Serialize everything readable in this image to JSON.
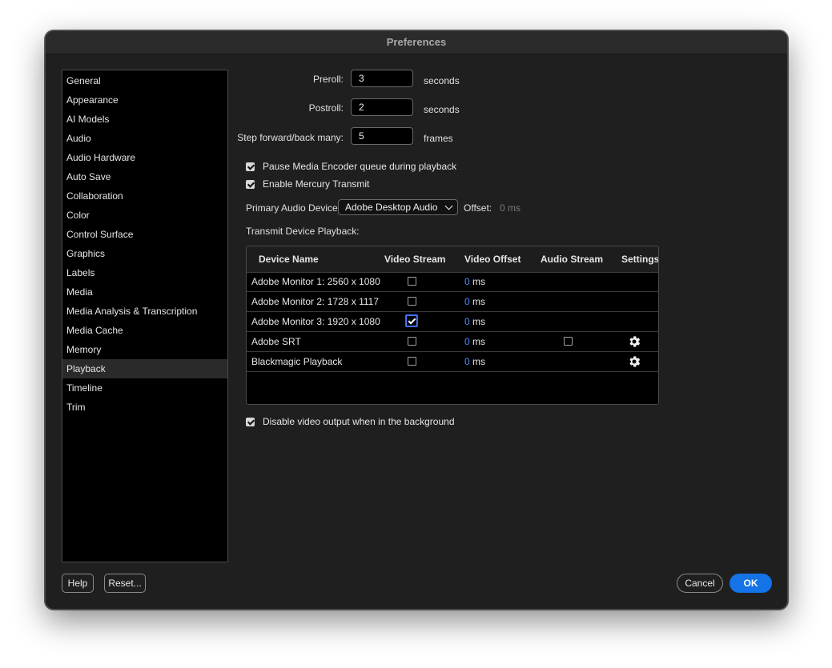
{
  "window": {
    "title": "Preferences"
  },
  "sidebar": {
    "items": [
      {
        "label": "General"
      },
      {
        "label": "Appearance"
      },
      {
        "label": "AI Models"
      },
      {
        "label": "Audio"
      },
      {
        "label": "Audio Hardware"
      },
      {
        "label": "Auto Save"
      },
      {
        "label": "Collaboration"
      },
      {
        "label": "Color"
      },
      {
        "label": "Control Surface"
      },
      {
        "label": "Graphics"
      },
      {
        "label": "Labels"
      },
      {
        "label": "Media"
      },
      {
        "label": "Media Analysis & Transcription"
      },
      {
        "label": "Media Cache"
      },
      {
        "label": "Memory"
      },
      {
        "label": "Playback",
        "active": true
      },
      {
        "label": "Timeline"
      },
      {
        "label": "Trim"
      }
    ]
  },
  "playback": {
    "preroll": {
      "label": "Preroll:",
      "value": "3",
      "unit": "seconds"
    },
    "postroll": {
      "label": "Postroll:",
      "value": "2",
      "unit": "seconds"
    },
    "step": {
      "label": "Step forward/back many:",
      "value": "5",
      "unit": "frames"
    },
    "pause_encoder": {
      "label": "Pause Media Encoder queue during playback",
      "checked": true
    },
    "mercury": {
      "label": "Enable Mercury Transmit",
      "checked": true
    },
    "audio_device": {
      "label": "Primary Audio Device:",
      "value": "Adobe Desktop Audio"
    },
    "offset": {
      "label": "Offset:",
      "value": "0 ms"
    },
    "transmit_label": "Transmit Device Playback:",
    "table": {
      "headers": [
        "Device Name",
        "Video Stream",
        "Video Offset",
        "Audio Stream",
        "Settings"
      ],
      "rows": [
        {
          "name": "Adobe Monitor 1: 2560 x 1080",
          "video_stream": false,
          "offset": "0",
          "unit": "ms",
          "audio_stream": null,
          "settings": false
        },
        {
          "name": "Adobe Monitor 2: 1728 x 1117",
          "video_stream": false,
          "offset": "0",
          "unit": "ms",
          "audio_stream": null,
          "settings": false
        },
        {
          "name": "Adobe Monitor 3: 1920 x 1080",
          "video_stream": true,
          "offset": "0",
          "unit": "ms",
          "audio_stream": null,
          "settings": false
        },
        {
          "name": "Adobe SRT",
          "video_stream": false,
          "offset": "0",
          "unit": "ms",
          "audio_stream": false,
          "settings": true
        },
        {
          "name": "Blackmagic Playback",
          "video_stream": false,
          "offset": "0",
          "unit": "ms",
          "audio_stream": null,
          "settings": true
        }
      ]
    },
    "disable_bg": {
      "label": "Disable video output when in the background",
      "checked": true
    }
  },
  "footer": {
    "help": "Help",
    "reset": "Reset...",
    "cancel": "Cancel",
    "ok": "OK"
  },
  "colors": {
    "accent": "#1473e6",
    "offset_value": "#4d8dff",
    "background": "#1f1f1f"
  }
}
